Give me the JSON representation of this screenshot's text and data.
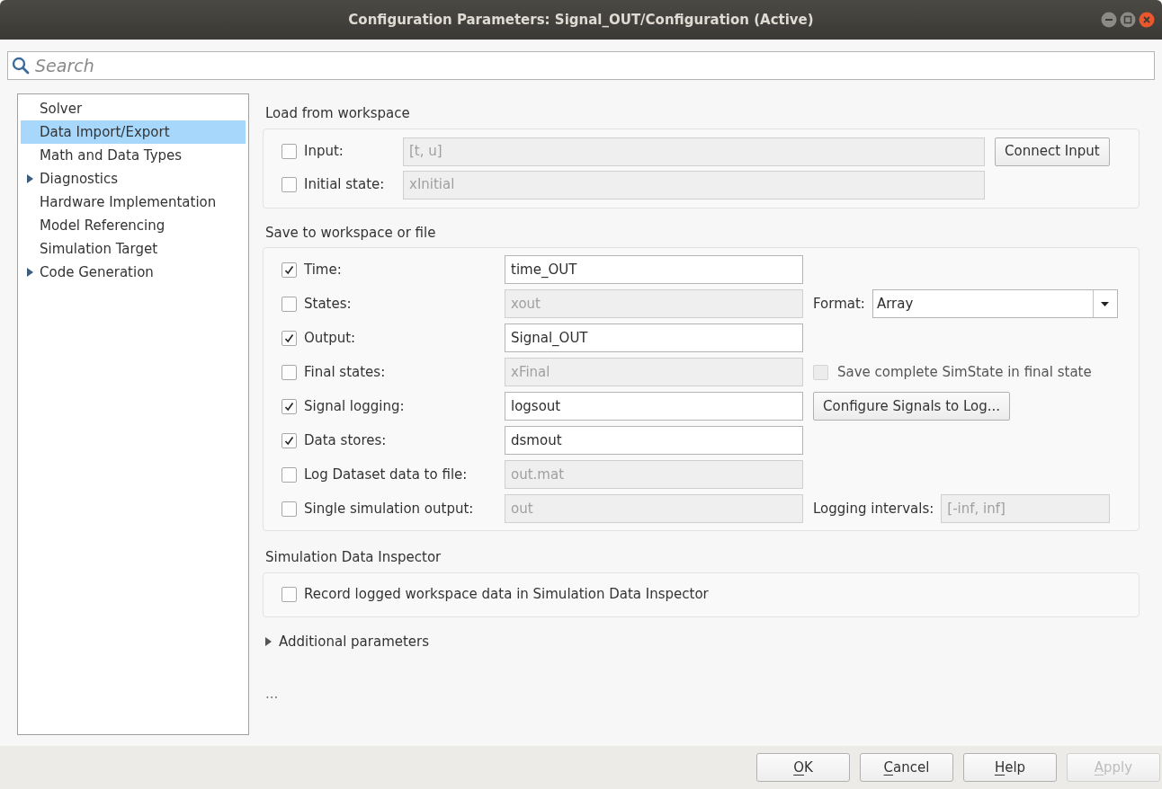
{
  "window": {
    "title": "Configuration Parameters: Signal_OUT/Configuration (Active)"
  },
  "search": {
    "placeholder": "Search"
  },
  "sidebar": {
    "items": [
      {
        "label": "Solver",
        "selected": false,
        "has_children": false
      },
      {
        "label": "Data Import/Export",
        "selected": true,
        "has_children": false
      },
      {
        "label": "Math and Data Types",
        "selected": false,
        "has_children": false
      },
      {
        "label": "Diagnostics",
        "selected": false,
        "has_children": true
      },
      {
        "label": "Hardware Implementation",
        "selected": false,
        "has_children": false
      },
      {
        "label": "Model Referencing",
        "selected": false,
        "has_children": false
      },
      {
        "label": "Simulation Target",
        "selected": false,
        "has_children": false
      },
      {
        "label": "Code Generation",
        "selected": false,
        "has_children": true
      }
    ]
  },
  "load_from_workspace": {
    "title": "Load from workspace",
    "rows": [
      {
        "label": "Input:",
        "checked": false,
        "value": "[t, u]",
        "extra": {
          "kind": "button",
          "label": "Connect Input"
        }
      },
      {
        "label": "Initial state:",
        "checked": false,
        "value": "xInitial"
      }
    ]
  },
  "save_to_workspace": {
    "title": "Save to workspace or file",
    "rows": [
      {
        "label": "Time:",
        "checked": true,
        "value": "time_OUT"
      },
      {
        "label": "States:",
        "checked": false,
        "value": "xout",
        "extra": {
          "kind": "dropdown",
          "label": "Format:",
          "value": "Array"
        }
      },
      {
        "label": "Output:",
        "checked": true,
        "value": "Signal_OUT"
      },
      {
        "label": "Final states:",
        "checked": false,
        "value": "xFinal",
        "extra": {
          "kind": "checkbox",
          "label": "Save complete SimState in final state",
          "checked": false,
          "disabled": true
        }
      },
      {
        "label": "Signal logging:",
        "checked": true,
        "value": "logsout",
        "extra": {
          "kind": "button",
          "label": "Configure Signals to Log..."
        }
      },
      {
        "label": "Data stores:",
        "checked": true,
        "value": "dsmout"
      },
      {
        "label": "Log Dataset data to file:",
        "checked": false,
        "value": "out.mat"
      },
      {
        "label": "Single simulation output:",
        "checked": false,
        "value": "out",
        "extra": {
          "kind": "field",
          "label": "Logging intervals:",
          "value": "[-inf, inf]",
          "disabled": true
        }
      }
    ]
  },
  "simulation_data_inspector": {
    "title": "Simulation Data Inspector",
    "checkbox": {
      "label": "Record logged workspace data in Simulation Data Inspector",
      "checked": false
    }
  },
  "additional_parameters": {
    "label": "Additional parameters",
    "expanded": false
  },
  "ellipsis": "...",
  "buttons": [
    {
      "label": "OK",
      "disabled": false
    },
    {
      "label": "Cancel",
      "disabled": false
    },
    {
      "label": "Help",
      "disabled": false
    },
    {
      "label": "Apply",
      "disabled": true
    }
  ]
}
